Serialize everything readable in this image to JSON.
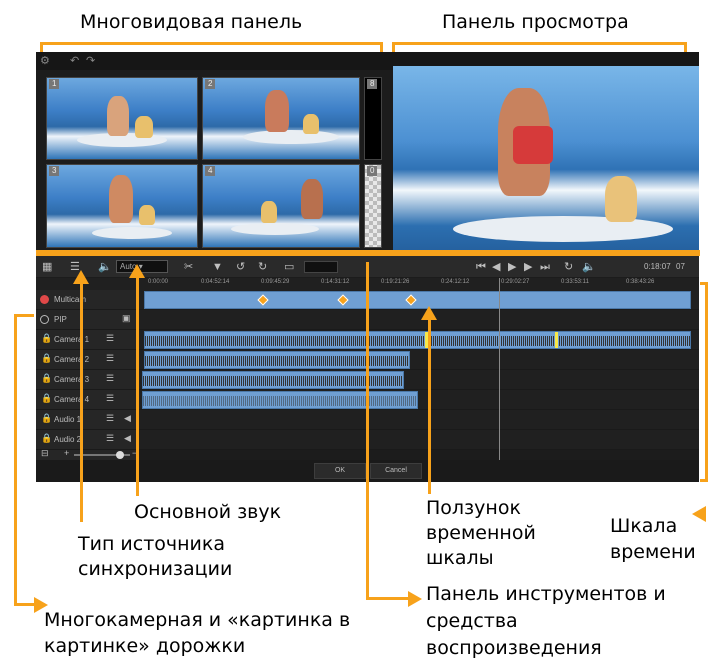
{
  "callouts": {
    "multiview": "Многовидовая панель",
    "preview": "Панель просмотра",
    "main_audio": "Основной звук",
    "sync_type_line1": "Тип источника",
    "sync_type_line2": "синхронизации",
    "scrubber_line1": "Ползунок",
    "scrubber_line2": "временной",
    "scrubber_line3": "шкалы",
    "timeline_line1": "Шкала",
    "timeline_line2": "времени",
    "toolbar_line1": "Панель инструментов и",
    "toolbar_line2": "средства",
    "toolbar_line3": "воспроизведения",
    "tracks_line1": "Многокамерная и «картинка в",
    "tracks_line2": "картинке» дорожки"
  },
  "multiview": {
    "quads": [
      "1",
      "2",
      "3",
      "4"
    ],
    "slim_top": "8",
    "slim_bottom": "0"
  },
  "toolbar": {
    "audio_select": "Auto",
    "timecode": "0:18:07",
    "unit": "07"
  },
  "ruler": {
    "ticks": [
      "0:00:00",
      "0:04:52:14",
      "0:09:45:29",
      "0:14:31:12",
      "0:19:21:26",
      "0:24:12:12",
      "0:29:02:27",
      "0:33:53:11",
      "0:38:43:26"
    ]
  },
  "tracks": {
    "multicam": "Multicam",
    "pip": "PIP",
    "camera1": "Camera 1",
    "camera2": "Camera 2",
    "camera3": "Camera 3",
    "camera4": "Camera 4",
    "audio1": "Audio 1",
    "audio2": "Audio 2"
  },
  "footer": {
    "ok": "OK",
    "cancel": "Cancel"
  }
}
